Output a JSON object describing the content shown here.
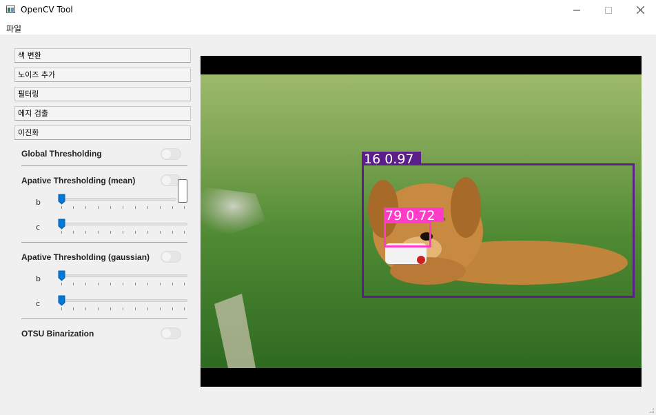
{
  "window": {
    "title": "OpenCV Tool"
  },
  "menu": {
    "file": "파일"
  },
  "sidebar": {
    "buttons": [
      "색 변환",
      "노이즈 추가",
      "필터링",
      "에지 검출",
      "이진화"
    ],
    "options": {
      "global": "Global Thresholding",
      "mean": "Apative Thresholding (mean)",
      "gaussian": "Apative Thresholding (gaussian)",
      "otsu": "OTSU Binarization"
    },
    "slider_labels": {
      "b": "b",
      "c": "c"
    },
    "sliders": {
      "mean_b": 0,
      "mean_c": 0,
      "gauss_b": 0,
      "gauss_c": 0
    }
  },
  "detections": [
    {
      "label": "16 0.97",
      "color": "#5c1e8a"
    },
    {
      "label": "79 0.72",
      "color": "#ff3cc8"
    }
  ],
  "icons": {
    "minimize": "minimize-icon",
    "maximize": "maximize-icon",
    "close": "close-icon",
    "app": "app-icon",
    "resize": "resize-grip-icon"
  }
}
